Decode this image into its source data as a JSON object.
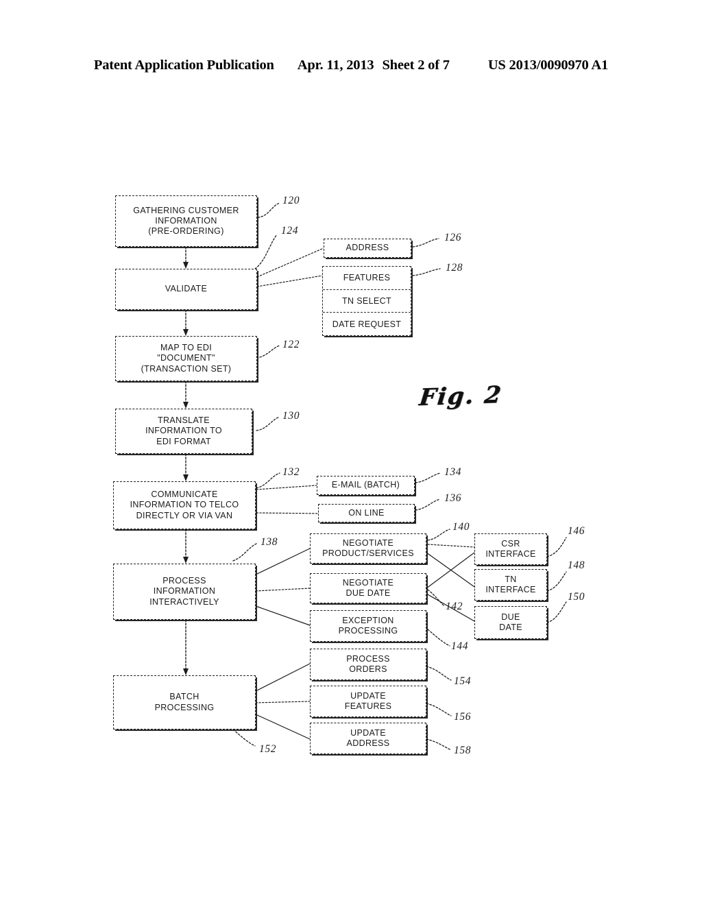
{
  "header": {
    "publication": "Patent Application Publication",
    "date": "Apr. 11, 2013",
    "sheet": "Sheet 2 of 7",
    "patent_number": "US 2013/0090970 A1"
  },
  "figure": {
    "label": "Fig. 2",
    "boxes": {
      "gathering": {
        "line1": "GATHERING CUSTOMER",
        "line2": "INFORMATION",
        "line3": "(PRE-ORDERING)"
      },
      "validate": {
        "line1": "VALIDATE"
      },
      "address": {
        "line1": "ADDRESS"
      },
      "features": {
        "line1": "FEATURES"
      },
      "tn_select": {
        "line1": "TN SELECT"
      },
      "date_request": {
        "line1": "DATE REQUEST"
      },
      "map_to_edi": {
        "line1": "MAP TO EDI",
        "line2": "\"DOCUMENT\"",
        "line3": "(TRANSACTION SET)"
      },
      "translate": {
        "line1": "TRANSLATE",
        "line2": "INFORMATION TO",
        "line3": "EDI FORMAT"
      },
      "communicate": {
        "line1": "COMMUNICATE",
        "line2": "INFORMATION TO TELCO",
        "line3": "DIRECTLY OR VIA VAN"
      },
      "email_batch": {
        "line1": "E-MAIL (BATCH)"
      },
      "on_line": {
        "line1": "ON LINE"
      },
      "process_interactive": {
        "line1": "PROCESS",
        "line2": "INFORMATION",
        "line3": "INTERACTIVELY"
      },
      "negotiate_product": {
        "line1": "NEGOTIATE",
        "line2": "PRODUCT/SERVICES"
      },
      "negotiate_due_date": {
        "line1": "NEGOTIATE",
        "line2": "DUE DATE"
      },
      "exception_processing": {
        "line1": "EXCEPTION",
        "line2": "PROCESSING"
      },
      "csr_interface": {
        "line1": "CSR",
        "line2": "INTERFACE"
      },
      "tn_interface": {
        "line1": "TN",
        "line2": "INTERFACE"
      },
      "due_date": {
        "line1": "DUE",
        "line2": "DATE"
      },
      "batch_processing": {
        "line1": "BATCH",
        "line2": "PROCESSING"
      },
      "process_orders": {
        "line1": "PROCESS",
        "line2": "ORDERS"
      },
      "update_features": {
        "line1": "UPDATE",
        "line2": "FEATURES"
      },
      "update_address": {
        "line1": "UPDATE",
        "line2": "ADDRESS"
      }
    },
    "refs": {
      "r120": "120",
      "r124": "124",
      "r126": "126",
      "r128": "128",
      "r122": "122",
      "r130": "130",
      "r132": "132",
      "r134": "134",
      "r136": "136",
      "r138": "138",
      "r140": "140",
      "r142": "142",
      "r144": "144",
      "r146": "146",
      "r148": "148",
      "r150": "150",
      "r152": "152",
      "r154": "154",
      "r156": "156",
      "r158": "158"
    }
  }
}
